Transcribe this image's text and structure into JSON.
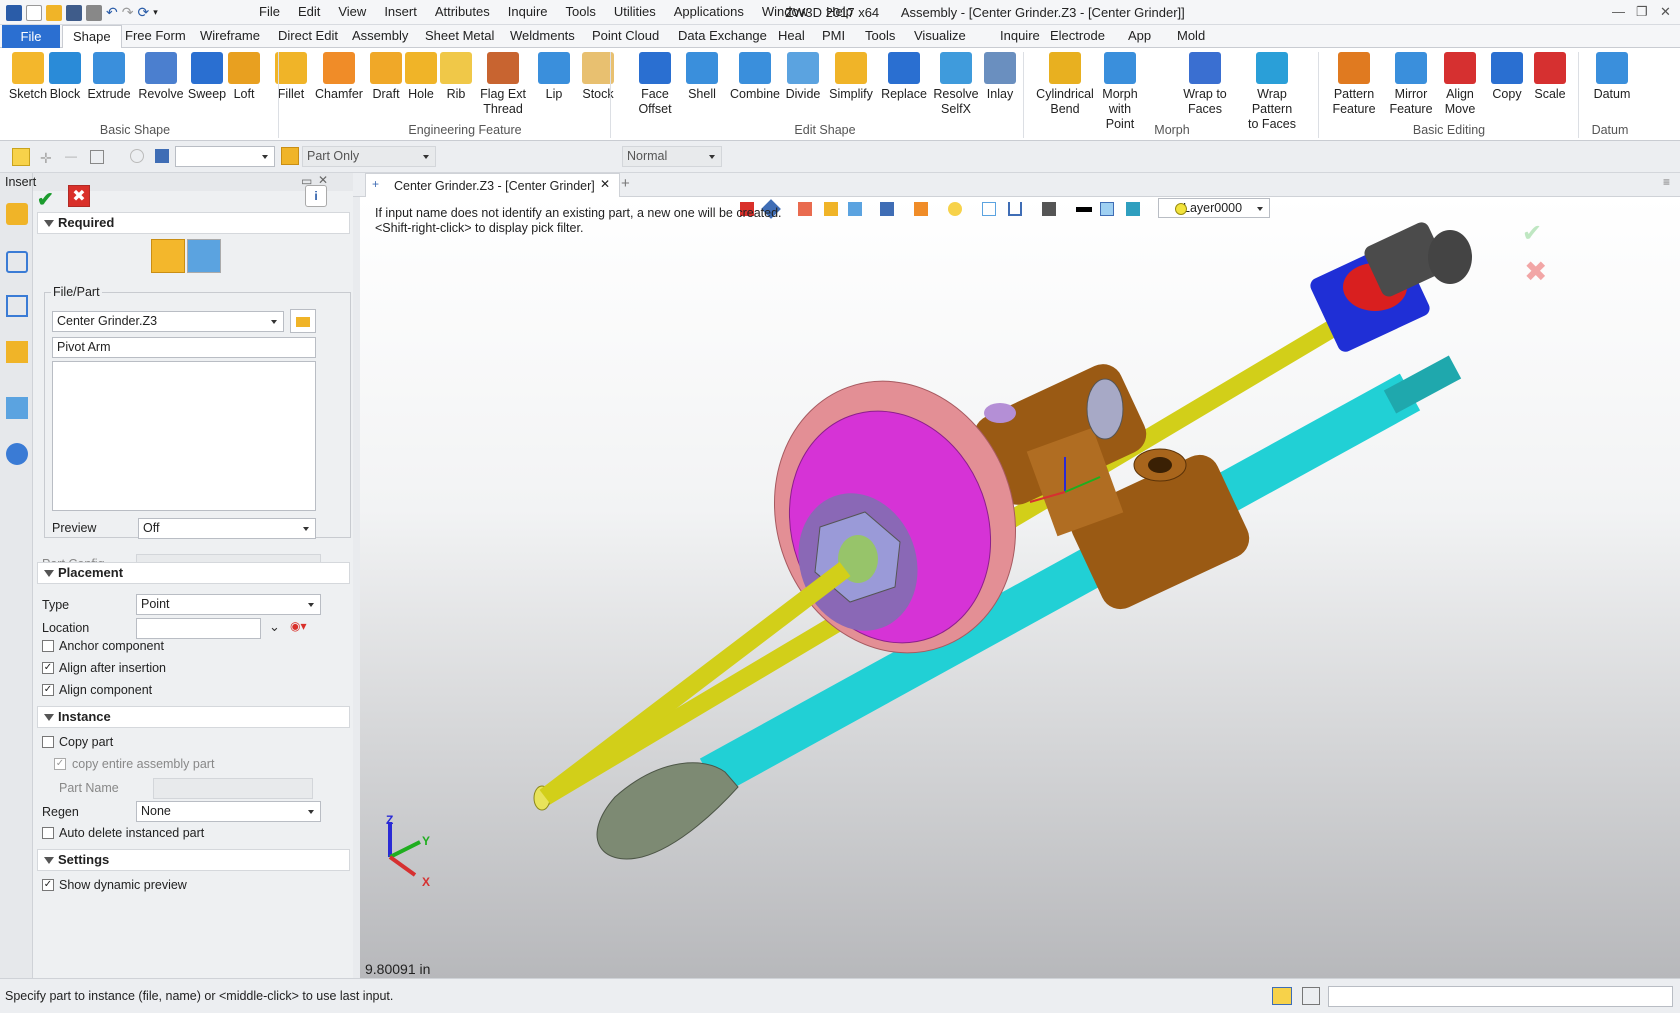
{
  "app_title": "ZW3D 2017  x64",
  "doc_title": "Assembly - [Center Grinder.Z3 - [Center Grinder]]",
  "main_menu": [
    "File",
    "Edit",
    "View",
    "Insert",
    "Attributes",
    "Inquire",
    "Tools",
    "Utilities",
    "Applications",
    "Window",
    "Help"
  ],
  "ribbon_tabs": [
    "File",
    "Shape",
    "Free Form",
    "Wireframe",
    "Direct Edit",
    "Assembly",
    "Sheet Metal",
    "Weldments",
    "Point Cloud",
    "Data Exchange",
    "Heal",
    "PMI",
    "Tools",
    "Visualize",
    "Inquire",
    "Electrode",
    "App",
    "Mold"
  ],
  "ribbon": {
    "buttons": [
      {
        "l1": "Sketch",
        "l2": ""
      },
      {
        "l1": "Block",
        "l2": ""
      },
      {
        "l1": "Extrude",
        "l2": ""
      },
      {
        "l1": "Revolve",
        "l2": ""
      },
      {
        "l1": "Sweep",
        "l2": ""
      },
      {
        "l1": "Loft",
        "l2": ""
      },
      {
        "l1": "Fillet",
        "l2": ""
      },
      {
        "l1": "Chamfer",
        "l2": ""
      },
      {
        "l1": "Draft",
        "l2": ""
      },
      {
        "l1": "Hole",
        "l2": ""
      },
      {
        "l1": "Rib",
        "l2": ""
      },
      {
        "l1": "Flag Ext",
        "l2": "Thread"
      },
      {
        "l1": "Lip",
        "l2": ""
      },
      {
        "l1": "Stock",
        "l2": ""
      },
      {
        "l1": "Face",
        "l2": "Offset"
      },
      {
        "l1": "Shell",
        "l2": ""
      },
      {
        "l1": "Combine",
        "l2": ""
      },
      {
        "l1": "Divide",
        "l2": ""
      },
      {
        "l1": "Simplify",
        "l2": ""
      },
      {
        "l1": "Replace",
        "l2": ""
      },
      {
        "l1": "Resolve",
        "l2": "SelfX"
      },
      {
        "l1": "Inlay",
        "l2": ""
      },
      {
        "l1": "Cylindrical",
        "l2": "Bend"
      },
      {
        "l1": "Morph with",
        "l2": "Point"
      },
      {
        "l1": "Wrap to",
        "l2": "Faces"
      },
      {
        "l1": "Wrap Pattern",
        "l2": "to Faces"
      },
      {
        "l1": "Pattern",
        "l2": "Feature"
      },
      {
        "l1": "Mirror",
        "l2": "Feature"
      },
      {
        "l1": "Align",
        "l2": "Move"
      },
      {
        "l1": "Copy",
        "l2": ""
      },
      {
        "l1": "Scale",
        "l2": ""
      },
      {
        "l1": "Datum",
        "l2": ""
      }
    ],
    "groups": [
      "Basic Shape",
      "Engineering Feature",
      "Edit Shape",
      "Morph",
      "Basic Editing",
      "Datum"
    ]
  },
  "toolbar2": {
    "filter_value": "Part Only",
    "render_mode": "Normal"
  },
  "panel": {
    "title": "Insert",
    "required_label": "Required",
    "file_part_label": "File/Part",
    "file_value": "Center Grinder.Z3",
    "part_name": "Pivot Arm",
    "preview_label": "Preview",
    "preview_value": "Off",
    "part_config_label": "Part Config",
    "placement_label": "Placement",
    "type_label": "Type",
    "type_value": "Point",
    "location_label": "Location",
    "anchor_label": "Anchor component",
    "align_after_label": "Align after insertion",
    "align_comp_label": "Align component",
    "instance_label": "Instance",
    "copy_part_label": "Copy part",
    "copy_entire_label": "copy entire assembly part",
    "part_name_label": "Part  Name",
    "regen_label": "Regen",
    "regen_value": "None",
    "auto_delete_label": "Auto delete instanced part",
    "settings_label": "Settings",
    "show_preview_label": "Show dynamic preview"
  },
  "doc_tab": "Center Grinder.Z3 - [Center Grinder]",
  "viewport": {
    "hint1": "If input name does not identify an existing part, a new one will be created.",
    "hint2": "<Shift-right-click> to display pick filter.",
    "layer": "Layer0000",
    "measure": "9.80091 in",
    "axes": {
      "x": "X",
      "y": "Y",
      "z": "Z"
    }
  },
  "status": "Specify part to instance (file, name) or <middle-click> to use last input."
}
